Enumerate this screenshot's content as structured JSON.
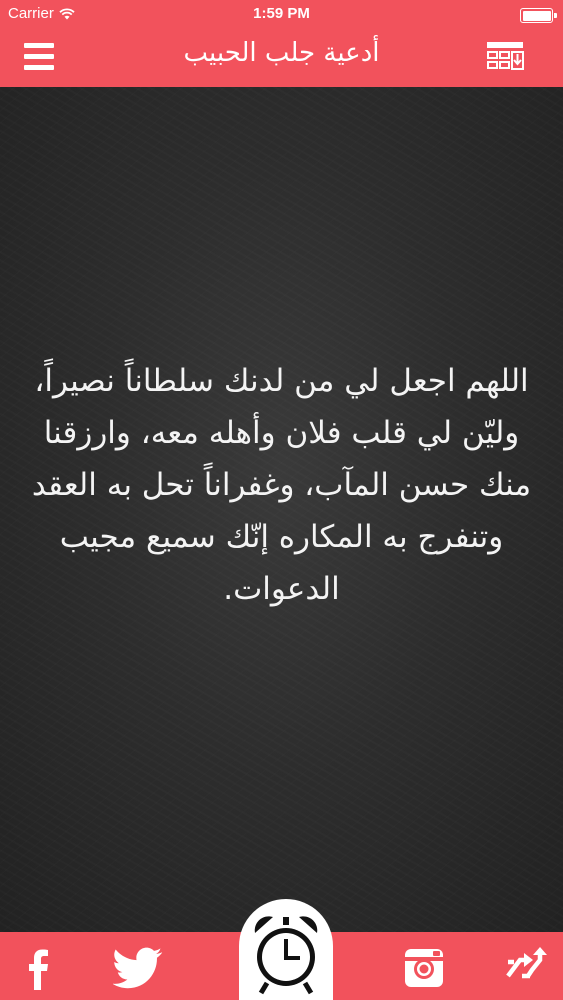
{
  "status_bar": {
    "carrier": "Carrier",
    "time": "1:59 PM"
  },
  "header": {
    "title": "أدعية جلب الحبيب",
    "menu_icon": "hamburger-menu-icon",
    "download_icon": "grid-download-icon"
  },
  "content": {
    "prayer": "اللهم اجعل لي من لدنك سلطاناً نصيراً، وليّن لي قلب فلان وأهله معه، وارزقنا منك حسن المآب، وغفراناً تحل به العقد وتنفرج به المكاره إنّك سميع مجيب الدعوات."
  },
  "bottom_bar": {
    "items": [
      {
        "icon": "facebook-icon"
      },
      {
        "icon": "twitter-icon"
      },
      {
        "icon": "alarm-clock-icon"
      },
      {
        "icon": "instagram-icon"
      },
      {
        "icon": "shuffle-icon"
      }
    ]
  },
  "colors": {
    "accent": "#f2525c",
    "board": "#2d2d2d",
    "text": "#f4f4f4"
  }
}
